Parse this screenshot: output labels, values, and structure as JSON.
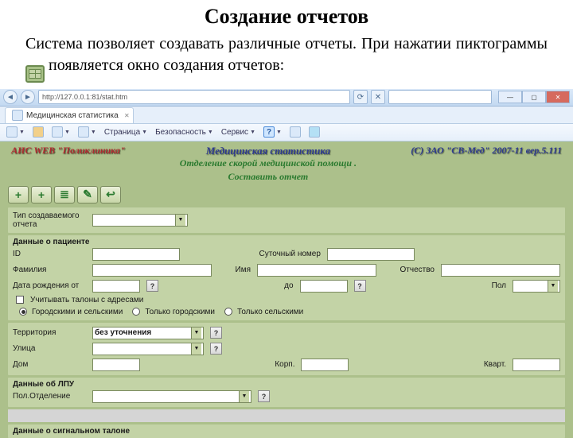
{
  "doc": {
    "title": "Создание отчетов",
    "p1_a": "Система позволяет создавать различные отчеты. При нажатии пиктограммы",
    "p1_b": "появляется окно создания отчетов:"
  },
  "browser": {
    "url": "http://127.0.0.1:81/stat.htm",
    "tab_title": "Медицинская статистика",
    "toolbar": {
      "page": "Страница",
      "security": "Безопасность",
      "tools": "Сервис"
    },
    "win": {
      "min": "—",
      "max": "▢",
      "close": "✕"
    }
  },
  "page": {
    "header": {
      "left": "АИС WEB \"Поликлиника\"",
      "center1": "Медицинская статистика",
      "center2": "Отделение скорой медицинской помощи .",
      "center3": "Составить отчет",
      "right": "(С) ЗАО \"СВ-Мед\" 2007-11 вер.5.111"
    },
    "toolbar_icons": [
      "plus-icon",
      "plus2-icon",
      "list-icon",
      "edit-icon",
      "back-icon"
    ],
    "report_type": {
      "label": "Тип создаваемого отчета",
      "value": ""
    },
    "sec_patient": "Данные о пациенте",
    "fields": {
      "id": "ID",
      "daily_no": "Суточный номер",
      "lastname": "Фамилия",
      "firstname": "Имя",
      "patronymic": "Отчество",
      "dob_from": "Дата рождения от",
      "dob_to": "до",
      "sex": "Пол",
      "addr_check": "Учитывать талоны с адресами",
      "radio_both": "Городскими и сельскими",
      "radio_city": "Только городскими",
      "radio_rural": "Только сельскими",
      "territory": "Территория",
      "territory_value": "без уточнения",
      "street": "Улица",
      "house": "Дом",
      "korp": "Корп.",
      "flat": "Кварт."
    },
    "sec_lpu": "Данные об ЛПУ",
    "lpu_field": "Пол.Отделение",
    "sec_signal": "Данные о сигнальном талоне",
    "help": "?"
  }
}
